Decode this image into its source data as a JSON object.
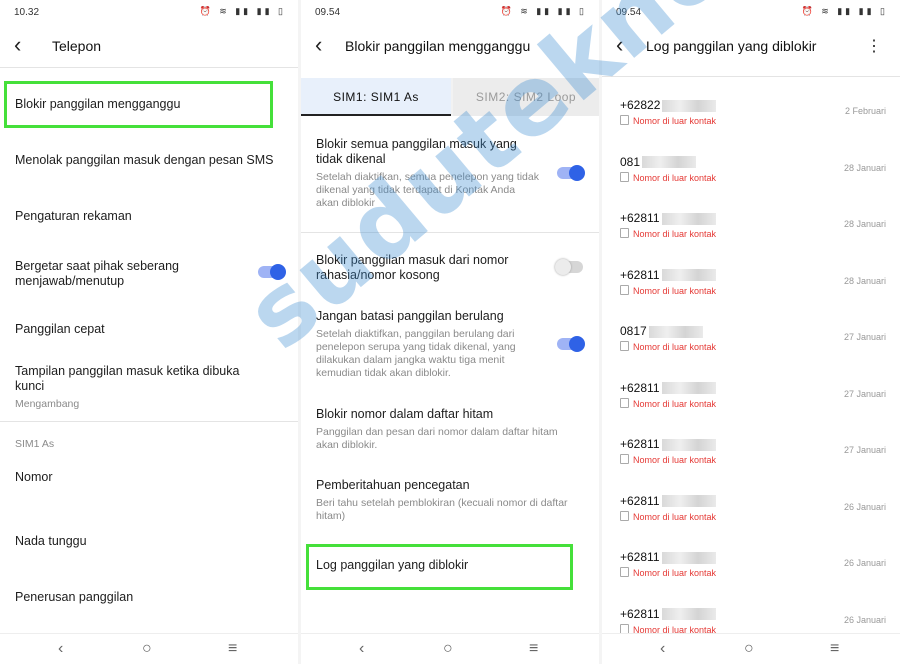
{
  "panel1": {
    "status_time": "10.32",
    "title": "Telepon",
    "items": [
      {
        "label": "Blokir panggilan mengganggu"
      },
      {
        "label": "Menolak panggilan masuk dengan pesan SMS"
      },
      {
        "label": "Pengaturan rekaman"
      },
      {
        "label": "Bergetar saat pihak seberang menjawab/menutup",
        "toggle": true
      },
      {
        "label": "Panggilan cepat"
      },
      {
        "label": "Tampilan panggilan masuk ketika dibuka kunci",
        "sub": "Mengambang"
      }
    ],
    "section": "SIM1 As",
    "sim_items": [
      {
        "label": "Nomor"
      },
      {
        "label": "Nada tunggu"
      },
      {
        "label": "Penerusan panggilan"
      }
    ]
  },
  "panel2": {
    "status_time": "09.54",
    "title": "Blokir panggilan mengganggu",
    "tabs": [
      "SIM1: SIM1 As",
      "SIM2: SIM2 Loop"
    ],
    "items": [
      {
        "label": "Blokir semua panggilan masuk yang tidak dikenal",
        "sub": "Setelah diaktifkan, semua penelepon yang tidak dikenal yang tidak terdapat di Kontak Anda akan diblokir",
        "toggle": true
      },
      {
        "label": "Blokir panggilan masuk dari nomor rahasia/nomor kosong",
        "toggle": false
      },
      {
        "label": "Jangan batasi panggilan berulang",
        "sub": "Setelah diaktifkan, panggilan berulang dari penelepon serupa yang tidak dikenal, yang dilakukan dalam jangka waktu tiga menit kemudian tidak akan diblokir.",
        "toggle": true
      },
      {
        "label": "Blokir nomor dalam daftar hitam",
        "sub": "Panggilan dan pesan dari nomor dalam daftar hitam akan diblokir."
      },
      {
        "label": "Pemberitahuan pencegatan",
        "sub": "Beri tahu setelah pemblokiran (kecuali nomor di daftar hitam)"
      },
      {
        "label": "Log panggilan yang diblokir"
      }
    ]
  },
  "panel3": {
    "status_time": "09.54",
    "title": "Log panggilan yang diblokir",
    "tag": "Nomor di luar kontak",
    "calls": [
      {
        "number": "+62822",
        "date": "2 Februari"
      },
      {
        "number": "081",
        "date": "28 Januari"
      },
      {
        "number": "+62811",
        "date": "28 Januari"
      },
      {
        "number": "+62811",
        "date": "28 Januari"
      },
      {
        "number": "0817",
        "date": "27 Januari"
      },
      {
        "number": "+62811",
        "date": "27 Januari"
      },
      {
        "number": "+62811",
        "date": "27 Januari"
      },
      {
        "number": "+62811",
        "date": "26 Januari"
      },
      {
        "number": "+62811",
        "date": "26 Januari"
      },
      {
        "number": "+62811",
        "date": "26 Januari"
      }
    ]
  },
  "watermark": "sudutekno",
  "accent": "#2f62e6",
  "highlight": "#45e03a",
  "tag_color": "#e53935"
}
